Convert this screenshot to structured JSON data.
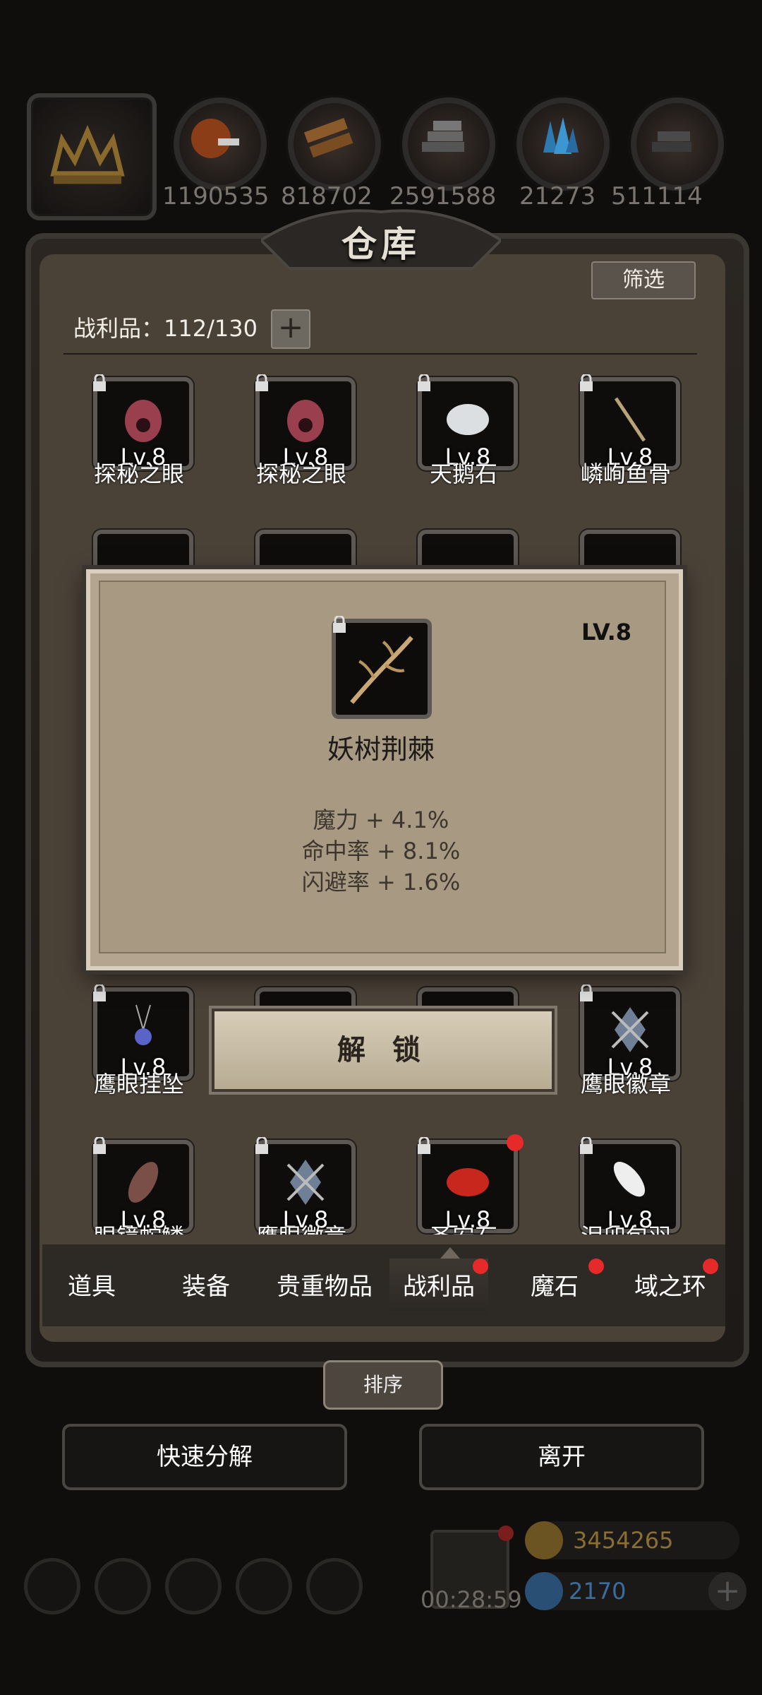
{
  "resources": {
    "values": [
      "1190535",
      "818702",
      "2591588",
      "21273",
      "511114"
    ]
  },
  "warehouse": {
    "title": "仓库",
    "filter_label": "筛选",
    "count_label": "战利品：112/130",
    "plus_label": "+"
  },
  "grid": {
    "row1": [
      {
        "level": "Lv.8",
        "name": "探秘之眼"
      },
      {
        "level": "Lv.8",
        "name": "探秘之眼"
      },
      {
        "level": "Lv.8",
        "name": "天鹅石"
      },
      {
        "level": "Lv.8",
        "name": "嶙峋鱼骨"
      }
    ],
    "row4": [
      {
        "level": "Lv.8",
        "name": "鹰眼挂坠"
      },
      {
        "level": "Lv.8",
        "name": "鹰眼徽章"
      }
    ],
    "row5": [
      {
        "level": "Lv.8",
        "name": "眼镜蛇鳞"
      },
      {
        "level": "Lv.8",
        "name": "鹰眼徽章"
      },
      {
        "level": "Lv.8",
        "name": "圣安石"
      },
      {
        "level": "Lv.8",
        "name": "泪卯包羽"
      }
    ]
  },
  "popup": {
    "level": "LV.8",
    "name": "妖树荆棘",
    "stats": [
      "魔力 + 4.1%",
      "命中率 + 8.1%",
      "闪避率 + 1.6%"
    ]
  },
  "unlock_label": "解 锁",
  "tabs": [
    "道具",
    "装备",
    "贵重物品",
    "战利品",
    "魔石",
    "域之环"
  ],
  "sort_label": "排序",
  "buttons": {
    "quick_decompose": "快速分解",
    "leave": "离开"
  },
  "hud": {
    "timer": "00:28:59",
    "gold": "3454265",
    "gems": "2170"
  },
  "colors": {
    "badge_red": "#e62a2a",
    "gold_text": "#9a7a3c",
    "gem_text": "#3f7fbf"
  }
}
